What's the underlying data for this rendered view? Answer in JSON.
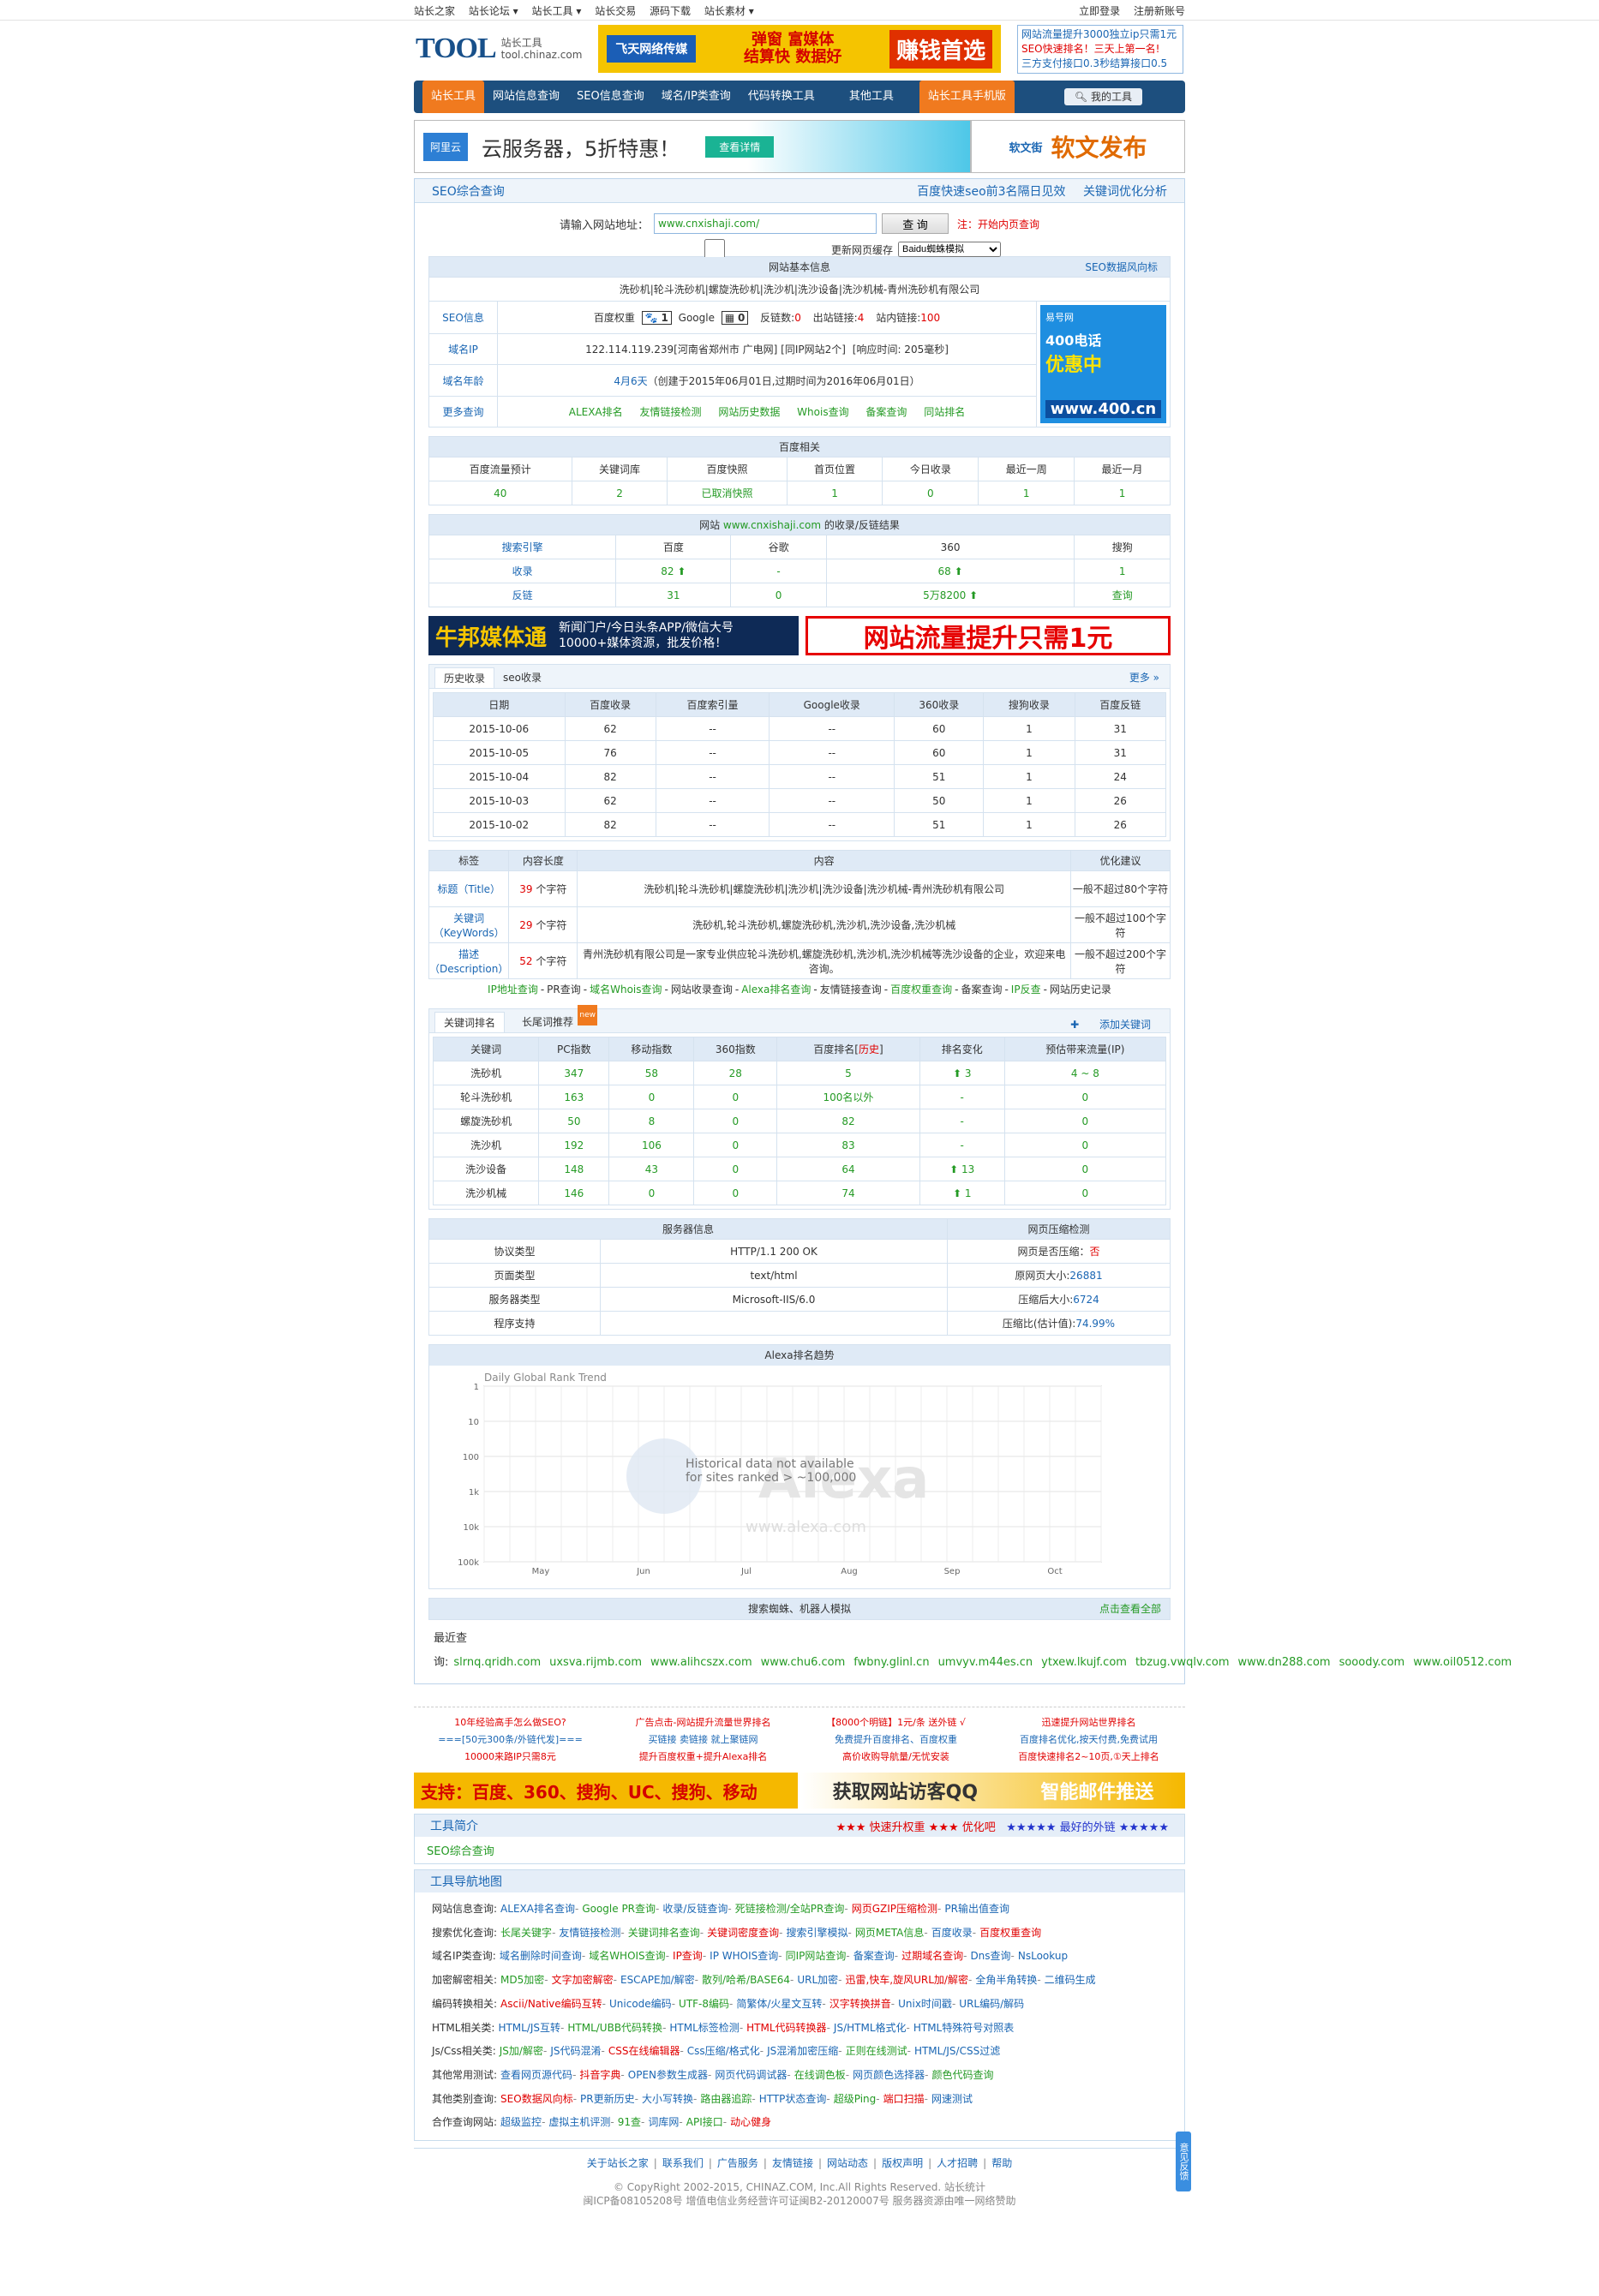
{
  "topbar": {
    "links": [
      "站长之家",
      "站长论坛 ▾",
      "站长工具 ▾",
      "站长交易",
      "源码下载",
      "站长素材 ▾"
    ],
    "login": "立即登录",
    "register": "注册新账号"
  },
  "header": {
    "logo": "TOOL",
    "logo_cn": "站长工具",
    "logo_url": "tool.chinaz.com",
    "banner": {
      "brand": "飞天网络传媒",
      "mid": "弹窗 富媒体\n结算快 数据好",
      "right": "赚钱首选"
    },
    "ads": [
      "网站流量提升3000独立ip只需1元",
      "SEO快速排名！三天上第一名!",
      "三方支付接口0.3秒结算接口0.5"
    ]
  },
  "nav": {
    "items": [
      "站长工具",
      "网站信息查询",
      "SEO信息查询",
      "域名/IP类查询",
      "代码转换工具",
      "其他工具",
      "站长工具手机版"
    ],
    "active": 0,
    "my_tools": "我的工具"
  },
  "ad_row": {
    "left_brand": "阿里云",
    "left_text": "云服务器，5折特惠！",
    "left_btn": "查看详情",
    "right_text": "软文发布",
    "right_brand": "软文街"
  },
  "seo": {
    "title": "SEO综合查询",
    "right_links": [
      "百度快速seo前3名隔日见效",
      "关键词优化分析"
    ],
    "label": "请输入网站地址：",
    "url": "www.cnxishaji.com/",
    "query_btn": "查 询",
    "note": "注：开始内页查询",
    "refresh": "更新网页缓存",
    "spider": "Baidu蜘蛛模拟"
  },
  "basic": {
    "caption": "网站基本信息",
    "risk_link": "SEO数据风向标",
    "site_title": "洗砂机|轮斗洗砂机|螺旋洗砂机|洗沙机|洗沙设备|洗沙机械-青州洗砂机有限公司",
    "seo_label": "SEO信息",
    "baidu_weight_label": "百度权重",
    "baidu_weight": "1",
    "google_label": "Google",
    "google_pr": "0",
    "backlinks_label": "反链数:",
    "backlinks": "0",
    "outlinks_label": "出站链接:",
    "outlinks": "4",
    "inlinks_label": "站内链接:",
    "inlinks": "100",
    "ip_label": "域名IP",
    "ip": "122.114.119.239[河南省郑州市 广电网]",
    "same_ip": "[同IP网站2个]",
    "resp": "[响应时间: 205毫秒]",
    "age_label": "域名年龄",
    "age": "4月6天",
    "age_detail": "（创建于2015年06月01日,过期时间为2016年06月01日）",
    "more_label": "更多查询",
    "more_links": [
      "ALEXA排名",
      "友情链接检测",
      "网站历史数据",
      "Whois查询",
      "备案查询",
      "同站排名"
    ],
    "ad_side": {
      "brand": "易号网",
      "line1": "400电话",
      "line2": "优惠中",
      "url": "www.400.cn"
    }
  },
  "baidu": {
    "caption": "百度相关",
    "headers": [
      "百度流量预计",
      "关键词库",
      "百度快照",
      "首页位置",
      "今日收录",
      "最近一周",
      "最近一月"
    ],
    "values": [
      "40",
      "2",
      "已取消快照",
      "1",
      "0",
      "1",
      "1"
    ]
  },
  "index": {
    "caption_pre": "网站 ",
    "caption_site": "www.cnxishaji.com",
    "caption_post": " 的收录/反链结果",
    "headers": [
      "搜索引擎",
      "百度",
      "谷歌",
      "360",
      "搜狗"
    ],
    "rows": [
      [
        "收录",
        "82 ⬆",
        "-",
        "68 ⬆",
        "1"
      ],
      [
        "反链",
        "31",
        "0",
        "5万8200 ⬆",
        "查询"
      ]
    ]
  },
  "ad_mid": {
    "left_brand": "牛邦媒体通",
    "left_text1": "新闻门户/今日头条APP/微信大号",
    "left_text2": "10000+媒体资源，批发价格！",
    "right": "网站流量提升只需1元"
  },
  "history": {
    "tabs": [
      "历史收录",
      "seo收录"
    ],
    "more": "更多 »",
    "headers": [
      "日期",
      "百度收录",
      "百度索引量",
      "Google收录",
      "360收录",
      "搜狗收录",
      "百度反链"
    ],
    "rows": [
      [
        "2015-10-06",
        "62",
        "--",
        "--",
        "60",
        "1",
        "31"
      ],
      [
        "2015-10-05",
        "76",
        "--",
        "--",
        "60",
        "1",
        "31"
      ],
      [
        "2015-10-04",
        "82",
        "--",
        "--",
        "51",
        "1",
        "24"
      ],
      [
        "2015-10-03",
        "62",
        "--",
        "--",
        "50",
        "1",
        "26"
      ],
      [
        "2015-10-02",
        "82",
        "--",
        "--",
        "51",
        "1",
        "26"
      ]
    ]
  },
  "meta": {
    "headers": [
      "标签",
      "内容长度",
      "内容",
      "优化建议"
    ],
    "rows": [
      {
        "tag": "标题（Title）",
        "len": "39",
        "unit": " 个字符",
        "content": "洗砂机|轮斗洗砂机|螺旋洗砂机|洗沙机|洗沙设备|洗沙机械-青州洗砂机有限公司",
        "tip": "一般不超过80个字符"
      },
      {
        "tag": "关键词（KeyWords）",
        "len": "29",
        "unit": " 个字符",
        "content": "洗砂机,轮斗洗砂机,螺旋洗砂机,洗沙机,洗沙设备,洗沙机械",
        "tip": "一般不超过100个字符"
      },
      {
        "tag": "描述（Description）",
        "len": "52",
        "unit": " 个字符",
        "content": "青州洗砂机有限公司是一家专业供应轮斗洗砂机,螺旋洗砂机,洗沙机,洗沙机械等洗沙设备的企业，欢迎来电咨询。",
        "tip": "一般不超过200个字符"
      }
    ],
    "links": [
      "IP地址查询",
      "PR查询",
      "域名Whois查询",
      "网站收录查询",
      "Alexa排名查询",
      "友情链接查询",
      "百度权重查询",
      "备案查询",
      "IP反查",
      "网站历史记录"
    ]
  },
  "keywords": {
    "tabs": [
      "关键词排名",
      "长尾词推荐"
    ],
    "new_badge": "new",
    "add": "添加关键词",
    "headers": [
      "关键词",
      "PC指数",
      "移动指数",
      "360指数",
      "百度排名[历史]",
      "排名变化",
      "预估带来流量(IP)"
    ],
    "rows": [
      [
        "洗砂机",
        "347",
        "58",
        "28",
        "5",
        "⬆ 3",
        "4 ~ 8"
      ],
      [
        "轮斗洗砂机",
        "163",
        "0",
        "0",
        "100名以外",
        "-",
        "0"
      ],
      [
        "螺旋洗砂机",
        "50",
        "8",
        "0",
        "82",
        "-",
        "0"
      ],
      [
        "洗沙机",
        "192",
        "106",
        "0",
        "83",
        "-",
        "0"
      ],
      [
        "洗沙设备",
        "148",
        "43",
        "0",
        "64",
        "⬆ 13",
        "0"
      ],
      [
        "洗沙机械",
        "146",
        "0",
        "0",
        "74",
        "⬆ 1",
        "0"
      ]
    ]
  },
  "server": {
    "caption_left": "服务器信息",
    "caption_right": "网页压缩检测",
    "rows": [
      [
        "协议类型",
        "HTTP/1.1 200 OK",
        "网页是否压缩：",
        "否"
      ],
      [
        "页面类型",
        "text/html",
        "原网页大小:",
        "26881"
      ],
      [
        "服务器类型",
        "Microsoft-IIS/6.0",
        "压缩后大小:",
        "6724"
      ],
      [
        "程序支持",
        "",
        "压缩比(估计值):",
        "74.99%"
      ]
    ]
  },
  "alexa": {
    "caption": "Alexa排名趋势",
    "chart_title": "Daily Global Rank Trend",
    "msg1": "Historical data not available",
    "msg2": "for sites ranked > ~100,000",
    "brand": "Alexa",
    "brand_url": "www.alexa.com",
    "yticks": [
      "1",
      "10",
      "100",
      "1k",
      "10k",
      "100k"
    ],
    "xticks": [
      "May",
      "Jun",
      "Jul",
      "Aug",
      "Sep",
      "Oct"
    ]
  },
  "spider": {
    "caption": "搜索蜘蛛、机器人模拟",
    "link": "点击查看全部",
    "recent_label": "最近查询:",
    "recent": [
      "slrnq.qridh.com",
      "uxsva.rijmb.com",
      "www.alihcszx.com",
      "www.chu6.com",
      "fwbny.glinl.cn",
      "umvyv.m44es.cn",
      "ytxew.lkujf.com",
      "tbzug.vwqlv.com",
      "www.dn288.com",
      "sooody.com",
      "www.oil0512.com"
    ]
  },
  "text_ads": [
    [
      "10年经验高手怎么做SEO?",
      "===[50元300条/外链代发]===",
      "10000来路IP只需8元"
    ],
    [
      "广告点击-网站提升流量世界排名",
      "买链接 卖链接 就上聚链网",
      "提升百度权重+提升Alexa排名"
    ],
    [
      "【8000个明链】1元/条 送外链 √",
      "免费提升百度排名、百度权重",
      "高价收购导航量/无忧安装"
    ],
    [
      "迅速提升网站世界排名",
      "百度排名优化,按天付费,免费试用",
      "百度快速排名2~10页,①天上排名"
    ]
  ],
  "ad_bottom": {
    "left": "支持：百度、360、搜狗、UC、搜狗、移动",
    "mid": "获取网站访客QQ",
    "right": "智能邮件推送"
  },
  "intro": {
    "title": "工具简介",
    "star1": "★★★ 快速升权重 ★★★ 优化吧",
    "star2": "★★★★★ 最好的外链 ★★★★★",
    "body": "SEO综合查询"
  },
  "sitemap": {
    "title": "工具导航地图",
    "rows": [
      {
        "h": "网站信息查询:",
        "items": [
          "ALEXA排名查询",
          "Google PR查询",
          "收录/反链查询",
          "死链接检测/全站PR查询",
          "网页GZIP压缩检测",
          "PR输出值查询"
        ]
      },
      {
        "h": "搜索优化查询:",
        "items": [
          "长尾关键字",
          "友情链接检测",
          "关键词排名查询",
          "关键词密度查询",
          "搜索引擎模拟",
          "网页META信息",
          "百度收录",
          "百度权重查询"
        ]
      },
      {
        "h": "域名IP类查询:",
        "items": [
          "域名删除时间查询",
          "域名WHOIS查询",
          "IP查询",
          "IP WHOIS查询",
          "同IP网站查询",
          "备案查询",
          "过期域名查询",
          "Dns查询",
          "NsLookup"
        ]
      },
      {
        "h": "加密解密相关:",
        "items": [
          "MD5加密",
          "文字加密解密",
          "ESCAPE加/解密",
          "散列/哈希/BASE64",
          "URL加密",
          "迅雷,快车,旋风URL加/解密",
          "全角半角转换",
          "二维码生成"
        ]
      },
      {
        "h": "编码转换相关:",
        "items": [
          "Ascii/Native编码互转",
          "Unicode编码",
          "UTF-8编码",
          "简繁体/火星文互转",
          "汉字转换拼音",
          "Unix时间戳",
          "URL编码/解码"
        ]
      },
      {
        "h": "HTML相关类:",
        "items": [
          "HTML/JS互转",
          "HTML/UBB代码转换",
          "HTML标签检测",
          "HTML代码转换器",
          "JS/HTML格式化",
          "HTML特殊符号对照表"
        ]
      },
      {
        "h": "Js/Css相关类:",
        "items": [
          "JS加/解密",
          "JS代码混淆",
          "CSS在线编辑器",
          "Css压缩/格式化",
          "JS混淆加密压缩",
          "正则在线测试",
          "HTML/JS/CSS过滤"
        ]
      },
      {
        "h": "其他常用测试:",
        "items": [
          "查看网页源代码",
          "抖音字典",
          "OPEN参数生成器",
          "网页代码调试器",
          "在线调色板",
          "网页颜色选择器",
          "颜色代码查询"
        ]
      },
      {
        "h": "其他类别查询:",
        "items": [
          "SEO数据风向标",
          "PR更新历史",
          "大小写转换",
          "路由器追踪",
          "HTTP状态查询",
          "超级Ping",
          "端口扫描",
          "网速测试"
        ]
      },
      {
        "h": "合作查询网站:",
        "items": [
          "超级监控",
          "虚拟主机评测",
          "91查",
          "词库网",
          "API接口",
          "动心健身"
        ]
      }
    ]
  },
  "footer": {
    "links": [
      "关于站长之家",
      "联系我们",
      "广告服务",
      "友情链接",
      "网站动态",
      "版权声明",
      "人才招聘",
      "帮助"
    ],
    "copy1": "© CopyRight 2002-2015, CHINAZ.COM, Inc.All Rights Reserved. 站长统计",
    "copy2": "闽ICP备08105208号  增值电信业务经营许可证闽B2-20120007号  服务器资源由唯一网络赞助"
  },
  "side_tab": "意见反馈"
}
